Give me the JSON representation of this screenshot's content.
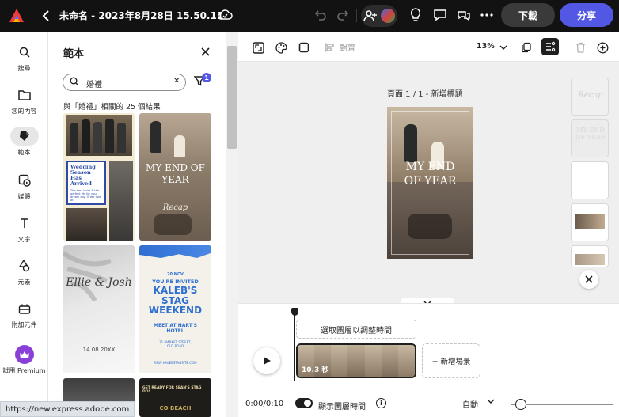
{
  "topbar": {
    "document_title": "未命名 - 2023年8月28日 15.50.11",
    "download_label": "下載",
    "share_label": "分享"
  },
  "rail": {
    "items": [
      {
        "label": "搜尋",
        "icon": "search-icon"
      },
      {
        "label": "您的內容",
        "icon": "folder-icon"
      },
      {
        "label": "範本",
        "icon": "templates-icon",
        "active": true
      },
      {
        "label": "媒體",
        "icon": "media-icon"
      },
      {
        "label": "文字",
        "icon": "text-icon"
      },
      {
        "label": "元素",
        "icon": "elements-icon"
      },
      {
        "label": "附加元件",
        "icon": "addons-icon"
      },
      {
        "label": "試用 Premium",
        "icon": "crown-icon"
      }
    ]
  },
  "panel": {
    "title": "範本",
    "search_value": "婚禮",
    "filter_count": "1",
    "result_count": "與「婚禮」相關的 25 個結果",
    "templates": [
      {
        "title": "Wedding Season Has Arrived",
        "subtitle": "The best looks & the perfect fits for your dream day. Order now at"
      },
      {
        "title": "MY END OF YEAR",
        "script": "Recap"
      },
      {
        "title": "Ellie & Josh",
        "date": "14.08.20XX"
      },
      {
        "date": "20 NOV",
        "invite": "YOU'RE INVITED",
        "title": "KALEB'S STAG WEEKEND",
        "meet": "MEET AT HART'S HOTEL",
        "address": "31 MARKET STREET, OLD ROAD",
        "rsvp": "RSVP KALEBSTAGSITE.COM"
      },
      {},
      {
        "title": "GET READY FOR SEAN'S STAG DO!",
        "subtitle": "CO BEACH"
      }
    ]
  },
  "toolbar": {
    "align_label": "對齊",
    "zoom_value": "13%"
  },
  "canvas": {
    "page_label": "頁面 1 / 1 - 新增標題",
    "page_title": "MY END OF YEAR",
    "page_thumbs": [
      {
        "script": "Recap"
      },
      {
        "title": "MY END OF YEAR"
      },
      {},
      {},
      {}
    ]
  },
  "timeline": {
    "select_layer_hint": "選取圖層以調整時間",
    "clip_duration": "10.3 秒",
    "add_scene_label": "+ 新增場景",
    "time_readout": "0:00/0:10",
    "show_layer_time_label": "顯示圖層時間",
    "show_layer_time_on": true,
    "auto_label": "自動",
    "zoom_level": 0.05
  },
  "status_bar": {
    "url": "https://new.express.adobe.com"
  },
  "colors": {
    "topbar_bg": "#121212",
    "share_accent": "#5258e4",
    "premium": "#8b3fd9",
    "canvas_bg": "#efefef"
  }
}
